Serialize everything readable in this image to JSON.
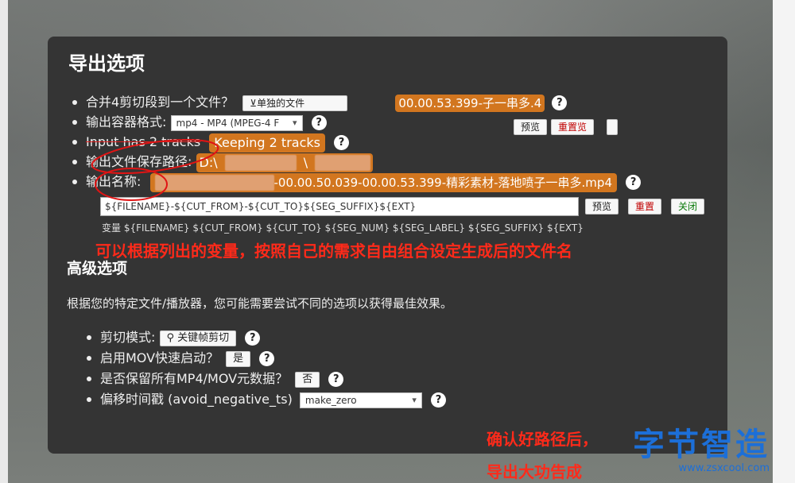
{
  "dialog": {
    "title": "导出选项",
    "merge_label": "合并4剪切段到一个文件？",
    "merge_button": "⊻单独的文件",
    "merge_filename_fragment": "00.00.53.399-子一串多.4",
    "container_label": "输出容器格式:",
    "container_select": "mp4 - MP4 (MPEG-4 F",
    "preview_button": "预览",
    "reset_preview_button": "重置览",
    "tracks_label": "Input has 2 tracks",
    "tracks_value": "Keeping 2 tracks",
    "save_path_label": "输出文件保存路径:",
    "save_path_prefix": "D:\\",
    "save_path_sep": "\\",
    "output_name_label": "输出名称:",
    "output_name_value": "-00.00.50.039-00.00.53.399-精彩素材-落地喷子一串多.mp4",
    "template_value": "${FILENAME}-${CUT_FROM}-${CUT_TO}${SEG_SUFFIX}${EXT}",
    "template_preview": "预览",
    "template_reset": "重置",
    "template_close": "关闭",
    "variables_text": "变量 ${FILENAME} ${CUT_FROM} ${CUT_TO} ${SEG_NUM} ${SEG_LABEL} ${SEG_SUFFIX} ${EXT}",
    "advanced_title": "高级选项",
    "advanced_desc": "根据您的特定文件/播放器，您可能需要尝试不同的选项以获得最佳效果。",
    "cut_mode_label": "剪切模式:",
    "cut_mode_button": "关键帧剪切",
    "mov_faststart_label": "启用MOV快速启动？",
    "mov_faststart_button": "是",
    "preserve_meta_label": "是否保留所有MP4/MOV元数据？",
    "preserve_meta_button": "否",
    "avoid_neg_label": "偏移时间戳 (avoid_negative_ts)",
    "avoid_neg_select": "make_zero",
    "help": "?"
  },
  "annotations": {
    "caption_variables": "可以根据列出的变量，按照自己的需求自由组合设定生成后的文件名",
    "caption_confirm": "确认好路径后，",
    "caption_export": "导出大功告成"
  },
  "watermark": {
    "big": "字节智造",
    "small": "www.zsxcool.com"
  },
  "colors": {
    "accent_orange": "#d2761f",
    "annotation_red": "#ff2a1a",
    "watermark_blue": "#1c6fd8"
  }
}
